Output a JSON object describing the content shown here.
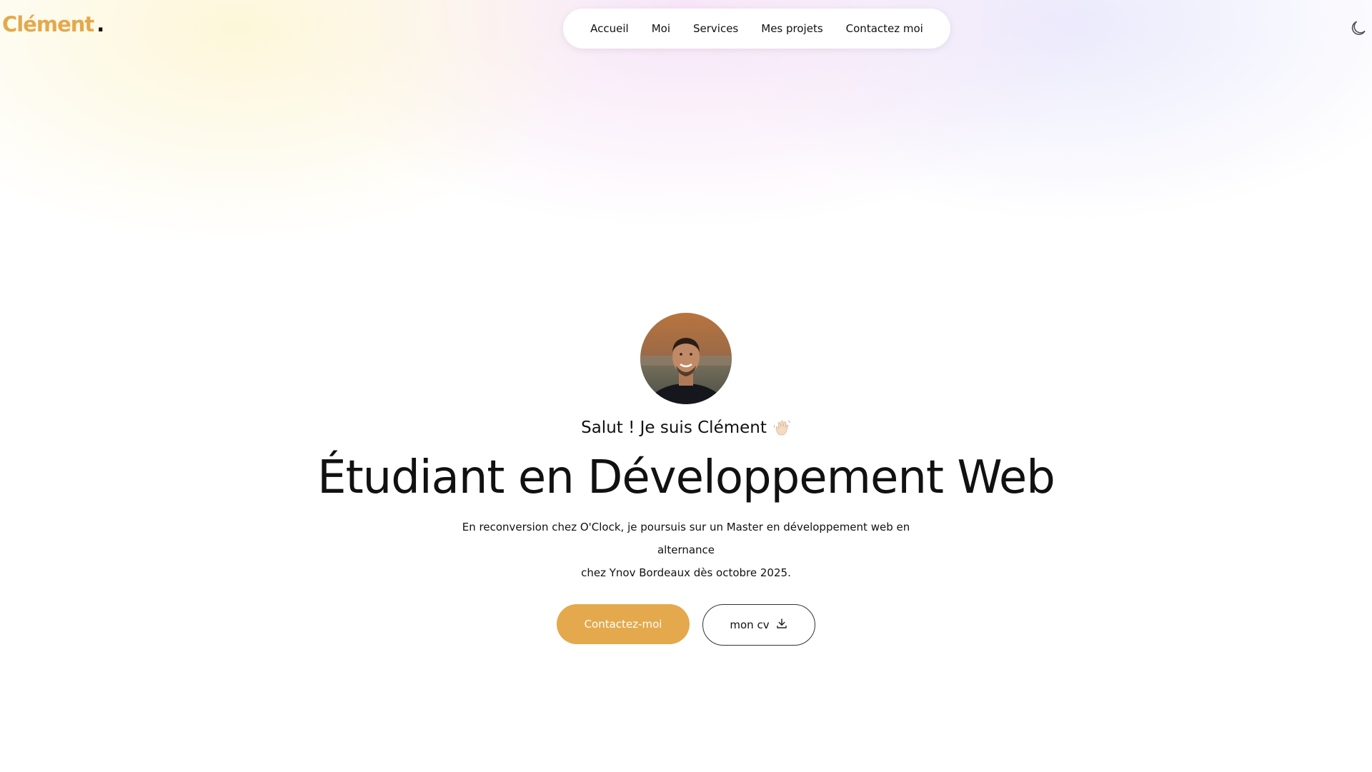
{
  "header": {
    "logo_text": "Clément",
    "logo_dot": ".",
    "nav_items": [
      "Accueil",
      "Moi",
      "Services",
      "Mes projets",
      "Contactez moi"
    ],
    "theme_icon": "moon-icon"
  },
  "hero": {
    "greeting": "Salut ! Je suis Clément",
    "greeting_icon": "waving-hand-icon",
    "headline": "Étudiant en Développement Web",
    "intro_line1": "En reconversion chez O'Clock, je poursuis sur un Master en développement web en alternance",
    "intro_line2": "chez Ynov Bordeaux dès octobre 2025.",
    "primary_button": "Contactez-moi",
    "secondary_button": "mon cv",
    "secondary_icon": "download-icon"
  },
  "colors": {
    "accent": "#e3a94c",
    "text": "#111111",
    "background": "#ffffff"
  }
}
